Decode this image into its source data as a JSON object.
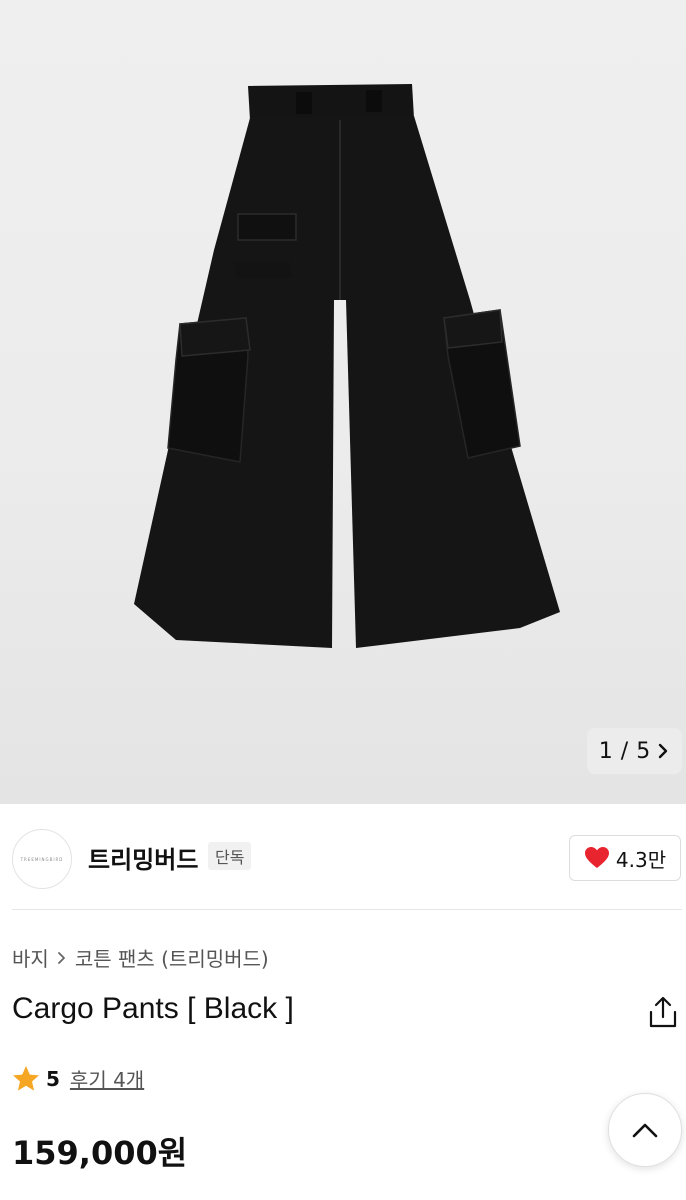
{
  "gallery": {
    "current": "1",
    "separator": "/",
    "total": "5",
    "image_alt": "black-wide-cargo-pants-photo"
  },
  "seller": {
    "avatar_text": "TREEMINGBIRD",
    "name": "트리밍버드",
    "badge": "단독",
    "likes": "4.3만"
  },
  "breadcrumb": {
    "category": "바지",
    "subcategory": "코튼 팬츠 (트리밍버드)"
  },
  "product": {
    "title": "Cargo Pants [ Black ]",
    "rating": "5",
    "reviews": "후기 4개",
    "price": "159,000원"
  },
  "colors": {
    "heart": "#e8242e",
    "star": "#f5a623",
    "text": "#111111"
  }
}
